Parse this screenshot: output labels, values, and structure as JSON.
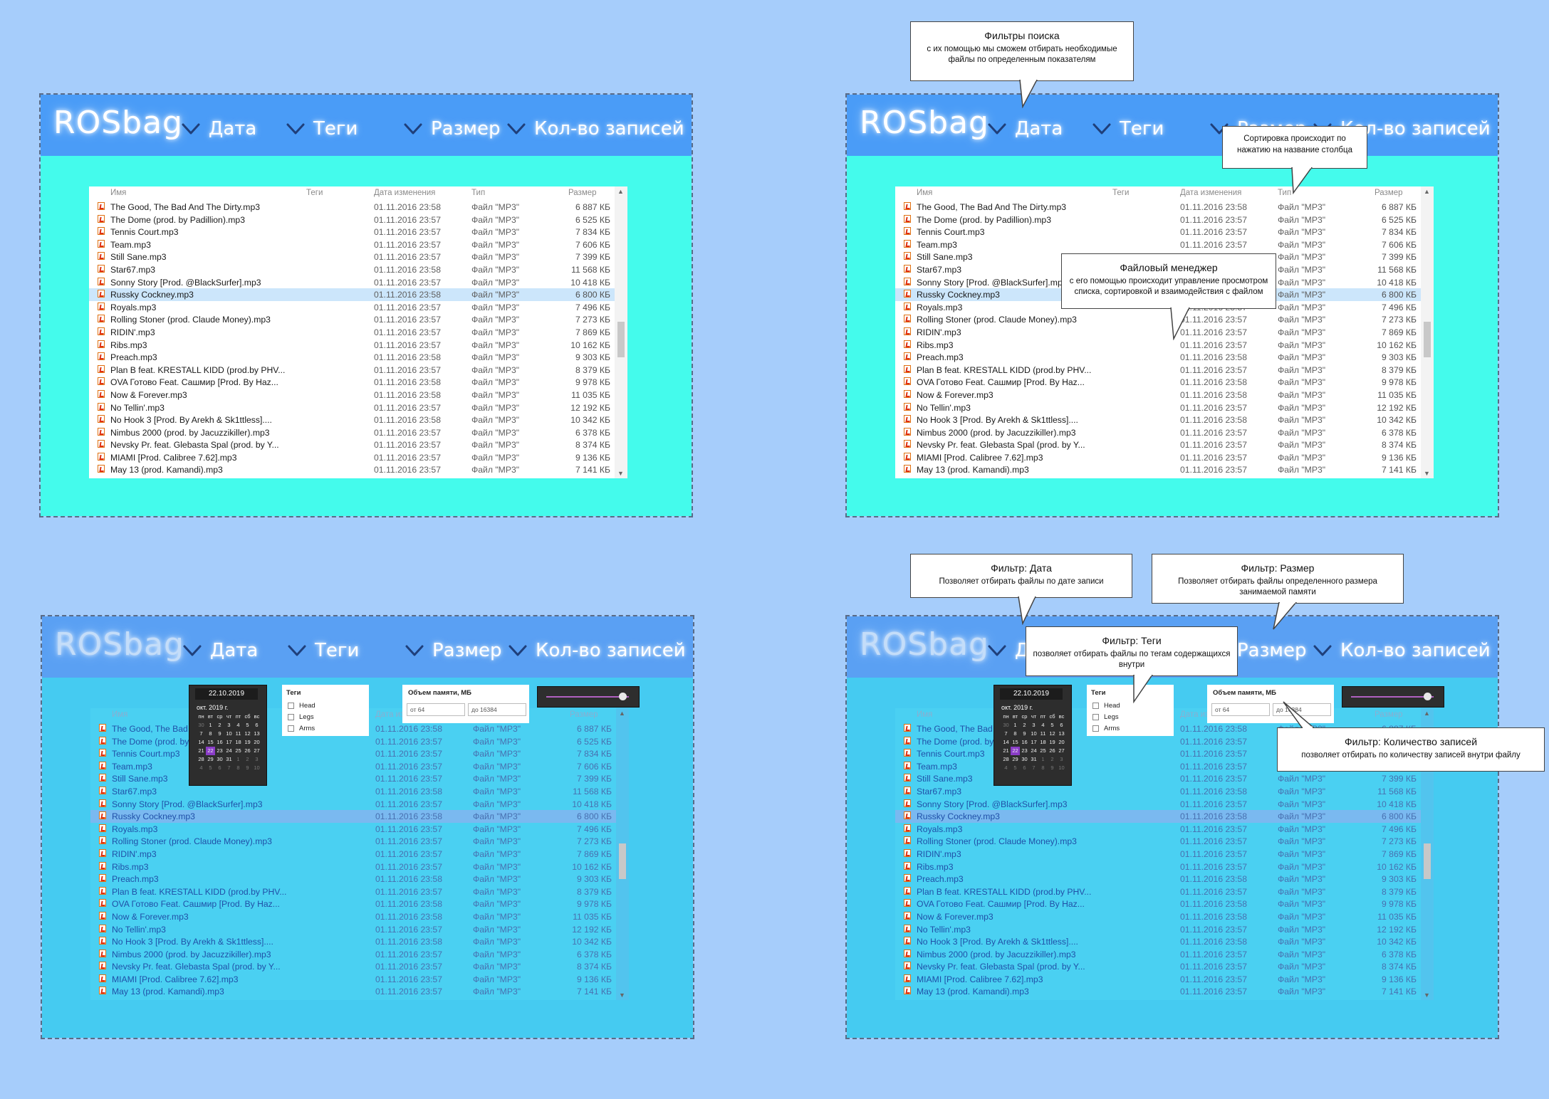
{
  "app": {
    "logo": "ROSbag",
    "nav": [
      "Дата",
      "Теги",
      "Размер",
      "Кол-во записей"
    ]
  },
  "columns": {
    "name": "Имя",
    "tags": "Теги",
    "date": "Дата изменения",
    "type": "Тип",
    "size": "Размер"
  },
  "files": [
    {
      "name": "The Good, The Bad And The Dirty.mp3",
      "date": "01.11.2016 23:58",
      "type": "Файл \"MP3\"",
      "size": "6 887 КБ"
    },
    {
      "name": "The Dome (prod. by Padillion).mp3",
      "date": "01.11.2016 23:57",
      "type": "Файл \"MP3\"",
      "size": "6 525 КБ"
    },
    {
      "name": "Tennis Court.mp3",
      "date": "01.11.2016 23:57",
      "type": "Файл \"MP3\"",
      "size": "7 834 КБ"
    },
    {
      "name": "Team.mp3",
      "date": "01.11.2016 23:57",
      "type": "Файл \"MP3\"",
      "size": "7 606 КБ"
    },
    {
      "name": "Still Sane.mp3",
      "date": "01.11.2016 23:57",
      "type": "Файл \"MP3\"",
      "size": "7 399 КБ"
    },
    {
      "name": "Star67.mp3",
      "date": "01.11.2016 23:58",
      "type": "Файл \"MP3\"",
      "size": "11 568 КБ"
    },
    {
      "name": "Sonny Story [Prod. @BlackSurfer].mp3",
      "date": "01.11.2016 23:57",
      "type": "Файл \"MP3\"",
      "size": "10 418 КБ"
    },
    {
      "name": "Russky Cockney.mp3",
      "date": "01.11.2016 23:58",
      "type": "Файл \"MP3\"",
      "size": "6 800 КБ",
      "selected": true
    },
    {
      "name": "Royals.mp3",
      "date": "01.11.2016 23:57",
      "type": "Файл \"MP3\"",
      "size": "7 496 КБ"
    },
    {
      "name": "Rolling Stoner (prod. Claude Money).mp3",
      "date": "01.11.2016 23:57",
      "type": "Файл \"MP3\"",
      "size": "7 273 КБ"
    },
    {
      "name": "RIDIN'.mp3",
      "date": "01.11.2016 23:57",
      "type": "Файл \"MP3\"",
      "size": "7 869 КБ"
    },
    {
      "name": "Ribs.mp3",
      "date": "01.11.2016 23:57",
      "type": "Файл \"MP3\"",
      "size": "10 162 КБ"
    },
    {
      "name": "Preach.mp3",
      "date": "01.11.2016 23:58",
      "type": "Файл \"MP3\"",
      "size": "9 303 КБ"
    },
    {
      "name": "Plan B feat. KRESTALL KIDD (prod.by PHV...",
      "date": "01.11.2016 23:57",
      "type": "Файл \"MP3\"",
      "size": "8 379 КБ"
    },
    {
      "name": "OVA Готово Feat. Сашмир [Prod. By Haz...",
      "date": "01.11.2016 23:58",
      "type": "Файл \"MP3\"",
      "size": "9 978 КБ"
    },
    {
      "name": "Now & Forever.mp3",
      "date": "01.11.2016 23:58",
      "type": "Файл \"MP3\"",
      "size": "11 035 КБ"
    },
    {
      "name": "No Tellin'.mp3",
      "date": "01.11.2016 23:57",
      "type": "Файл \"MP3\"",
      "size": "12 192 КБ"
    },
    {
      "name": "No Hook 3 [Prod. By Arekh & Sk1ttless]....",
      "date": "01.11.2016 23:58",
      "type": "Файл \"MP3\"",
      "size": "10 342 КБ"
    },
    {
      "name": "Nimbus 2000 (prod. by Jacuzzikiller).mp3",
      "date": "01.11.2016 23:57",
      "type": "Файл \"MP3\"",
      "size": "6 378 КБ"
    },
    {
      "name": "Nevsky Pr. feat. Glebasta Spal (prod. by Y...",
      "date": "01.11.2016 23:57",
      "type": "Файл \"MP3\"",
      "size": "8 374 КБ"
    },
    {
      "name": "MIAMI [Prod. Calibree 7.62].mp3",
      "date": "01.11.2016 23:57",
      "type": "Файл \"MP3\"",
      "size": "9 136 КБ"
    },
    {
      "name": "May 13 (prod. Kamandi).mp3",
      "date": "01.11.2016 23:57",
      "type": "Файл \"MP3\"",
      "size": "7 141 КБ"
    }
  ],
  "filters": {
    "date_value": "22.10.2019",
    "month": "окт. 2019 г.",
    "weekdays": [
      "пн",
      "вт",
      "ср",
      "чт",
      "пт",
      "сб",
      "вс"
    ],
    "days": [
      "30",
      "1",
      "2",
      "3",
      "4",
      "5",
      "6",
      "7",
      "8",
      "9",
      "10",
      "11",
      "12",
      "13",
      "14",
      "15",
      "16",
      "17",
      "18",
      "19",
      "20",
      "21",
      "22",
      "23",
      "24",
      "25",
      "26",
      "27",
      "28",
      "29",
      "30",
      "31",
      "1",
      "2",
      "3",
      "4",
      "5",
      "6",
      "7",
      "8",
      "9",
      "10"
    ],
    "selected_day": "22",
    "tags_title": "Теги",
    "tags": [
      "Head",
      "Legs",
      "Arms"
    ],
    "size_title": "Объем памяти, МБ",
    "size_from": "от 64",
    "size_to": "до 16384",
    "records_level": 0.97
  },
  "callouts": {
    "search_filters": {
      "title": "Фильтры поиска",
      "text": "с их помощью мы сможем отбирать необходимые файлы по определенным показателям"
    },
    "sort": {
      "text": "Сортировка происходит по нажатию на название столбца"
    },
    "file_manager": {
      "title": "Файловый менеджер",
      "text": "с его помощью происходит управление просмотром списка, сортировкой и взаимодействия с файлом"
    },
    "filter_date": {
      "title": "Фильтр: Дата",
      "text": "Позволяет отбирать файлы по дате записи"
    },
    "filter_size": {
      "title": "Фильтр: Размер",
      "text": "Позволяет отбирать файлы определенного размера занимаемой памяти"
    },
    "filter_tags": {
      "title": "Фильтр: Теги",
      "text": "позволяет отбирать файлы по тегам содержащихся внутри"
    },
    "filter_count": {
      "title": "Фильтр: Количество записей",
      "text": "позволяет отбирать по количеству записей внутри файлу"
    }
  }
}
